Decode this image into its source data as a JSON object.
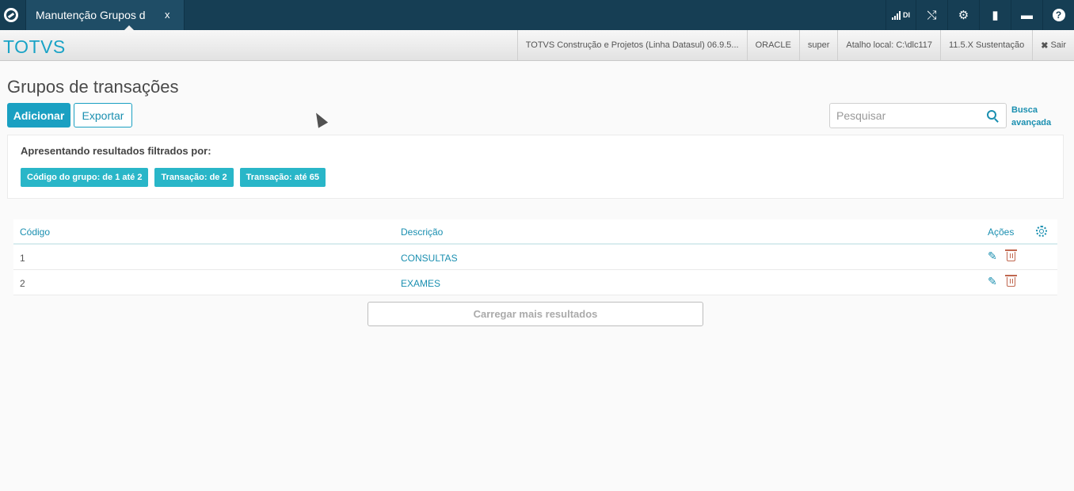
{
  "topbar": {
    "tab_label": "Manutenção Grupos d",
    "tab_close": "x",
    "signal_label": "DI",
    "icons": [
      "logo-icon",
      "signal-icon",
      "shuffle-icon",
      "gear-icon",
      "document-icon",
      "chat-icon",
      "help-icon"
    ]
  },
  "infobar": {
    "brand": "TOTVS",
    "product": "TOTVS Construção e Projetos (Linha Datasul) 06.9.5...",
    "database": "ORACLE",
    "user": "super",
    "shortcut": "Atalho local: C:\\dlc117",
    "version": "11.5.X Sustentação",
    "logout": "Sair"
  },
  "page": {
    "title": "Grupos de transações",
    "add_label": "Adicionar",
    "export_label": "Exportar",
    "search_placeholder": "Pesquisar",
    "advanced_search": "Busca avançada"
  },
  "filters": {
    "title": "Apresentando resultados filtrados por:",
    "chips": [
      "Código do grupo: de 1 até 2",
      "Transação: de 2",
      "Transação: até 65"
    ]
  },
  "table": {
    "headers": {
      "code": "Código",
      "description": "Descrição",
      "actions": "Ações"
    },
    "rows": [
      {
        "code": "1",
        "description": "CONSULTAS"
      },
      {
        "code": "2",
        "description": "EXAMES"
      }
    ],
    "load_more": "Carregar mais resultados"
  },
  "colors": {
    "topbar": "#163e54",
    "accent": "#1aa0c2",
    "chip": "#29b6c8",
    "delete": "#c0674f"
  }
}
